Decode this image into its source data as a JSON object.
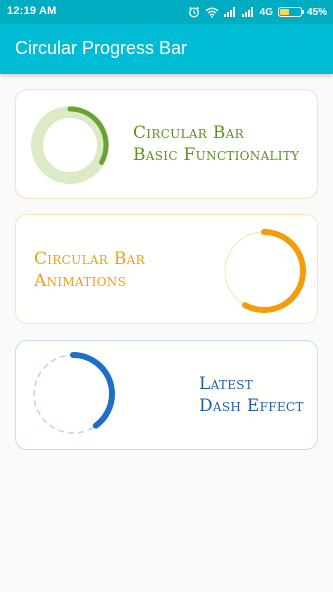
{
  "status_bar": {
    "time": "12:19 AM",
    "network": "4G",
    "battery_percent": "45%",
    "battery_level": 0.45,
    "background_color": "#00acc1",
    "icons": [
      "alarm-icon",
      "wifi-icon",
      "signal-icon",
      "signal-icon",
      "battery-icon"
    ]
  },
  "app_bar": {
    "title": "Circular Progress Bar",
    "background_color": "#00bcd4"
  },
  "cards": [
    {
      "line1": "Circular Bar",
      "line2": "Basic Functionality",
      "color": "#5f8e23",
      "progress": 0.33,
      "progress_color": "#6aa332",
      "track_color": "#dcebc7"
    },
    {
      "line1": "Circular Bar",
      "line2": "Animations",
      "color": "#f29d16",
      "progress": 0.58,
      "progress_color": "#f49c0b",
      "track_color": "#fbe9b5"
    },
    {
      "line1": "Latest",
      "line2": "Dash Effect",
      "color": "#1f5fae",
      "progress": 0.4,
      "progress_color": "#1e6fc6",
      "track_color": "#b6d4f1"
    }
  ]
}
